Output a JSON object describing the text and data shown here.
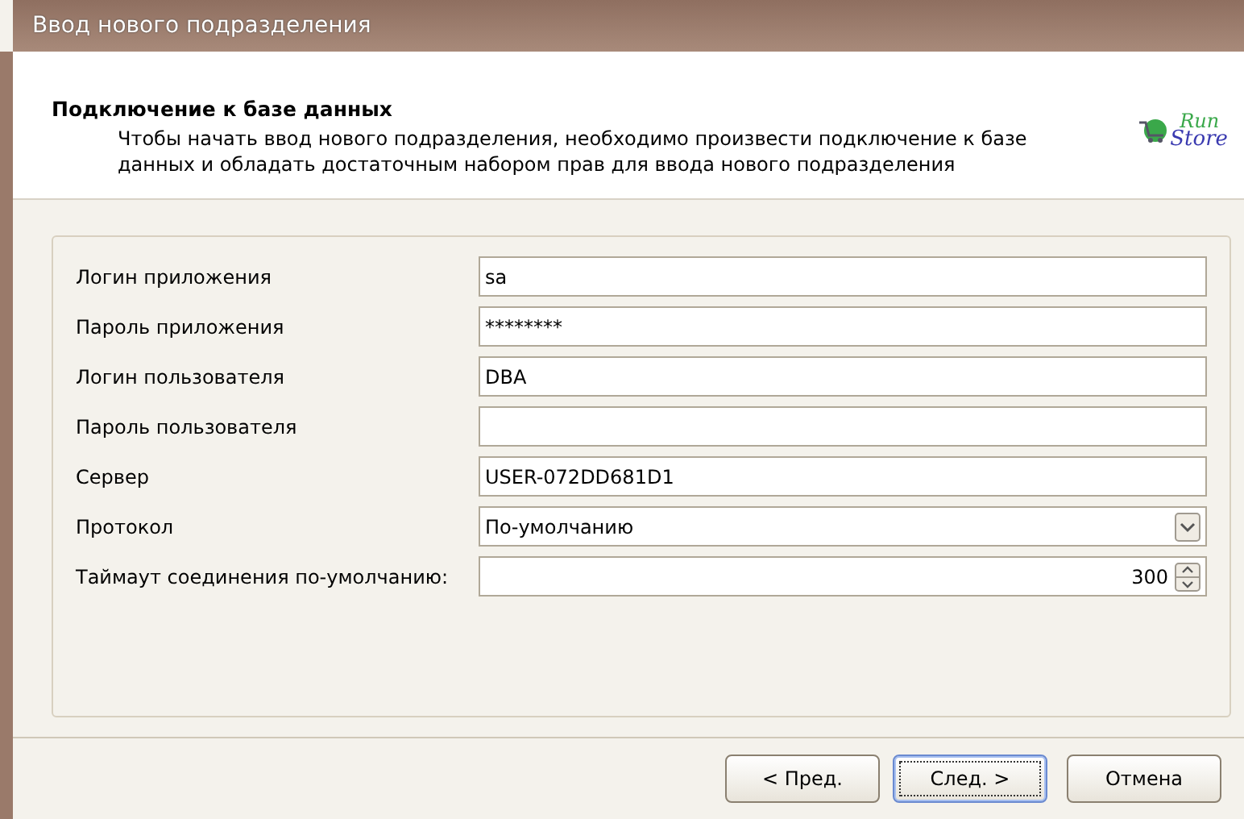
{
  "window": {
    "title": "Ввод нового подразделения"
  },
  "header": {
    "title": "Подключение к базе данных",
    "description": "Чтобы начать ввод нового подразделения, необходимо произвести подключение к базе данных и обладать достаточным набором прав для ввода нового подразделения",
    "logo": {
      "top": "Run",
      "bottom": "Store"
    }
  },
  "fields": [
    {
      "label": "Логин приложения",
      "kind": "text",
      "value": "sa"
    },
    {
      "label": "Пароль приложения",
      "kind": "text",
      "value": "********"
    },
    {
      "label": "Логин пользователя",
      "kind": "text",
      "value": "DBA"
    },
    {
      "label": "Пароль пользователя",
      "kind": "text"
    },
    {
      "label": "Сервер",
      "kind": "text",
      "value": "USER-072DD681D1"
    },
    {
      "label": "Протокол",
      "kind": "select",
      "value": "По-умолчанию"
    },
    {
      "label": "Таймаут соединения по-умолчанию:",
      "kind": "spin",
      "value": "300"
    }
  ],
  "buttons": [
    {
      "label": "< Пред.",
      "focused": false
    },
    {
      "label": "След. >",
      "focused": true
    },
    {
      "label": "Отмена",
      "focused": false
    }
  ]
}
